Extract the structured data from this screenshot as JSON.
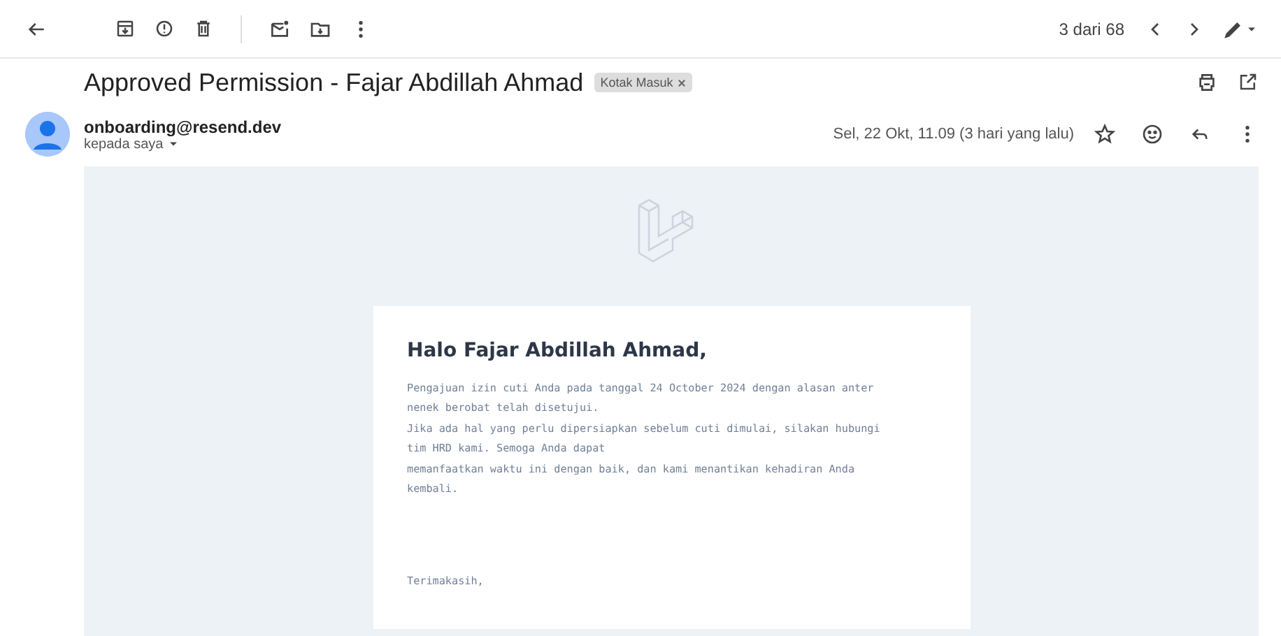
{
  "toolbar": {
    "counter": "3 dari 68"
  },
  "subject": {
    "title": "Approved Permission - Fajar Abdillah Ahmad",
    "label": "Kotak Masuk"
  },
  "sender": {
    "address": "onboarding@resend.dev",
    "recipient": "kepada saya",
    "date": "Sel, 22 Okt, 11.09 (3 hari yang lalu)",
    "starred": false
  },
  "message": {
    "greeting": "Halo Fajar Abdillah Ahmad,",
    "lines": [
      "Pengajuan izin cuti Anda pada tanggal 24 October 2024 dengan alasan anter",
      "nenek berobat telah disetujui.",
      "Jika ada hal yang perlu dipersiapkan sebelum cuti dimulai, silakan hubungi",
      "tim HRD kami. Semoga Anda dapat",
      "memanfaatkan waktu ini dengan baik, dan kami menantikan kehadiran Anda",
      "kembali."
    ],
    "closing": "Terimakasih,"
  }
}
